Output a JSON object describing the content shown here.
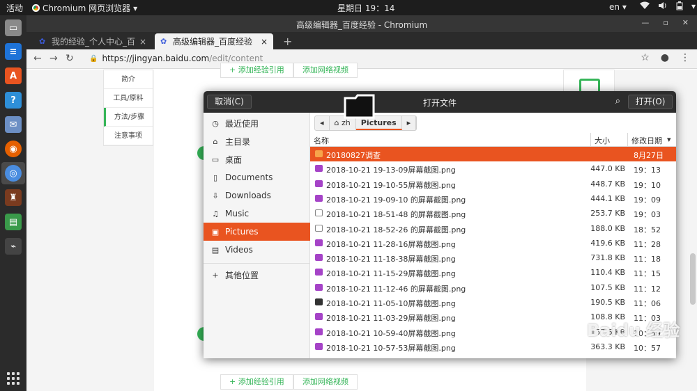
{
  "topbar": {
    "activities": "活动",
    "app_name": "Chromium 网页浏览器",
    "app_caret": "▾",
    "clock": "星期日 19：14",
    "lang": "en",
    "lang_caret": "▾"
  },
  "dock": {
    "icons": [
      "files-icon",
      "writer-icon",
      "software-icon",
      "help-icon",
      "mail-icon",
      "firefox-icon",
      "chromium-icon",
      "wine-icon",
      "system-monitor-icon",
      "scanner-icon"
    ]
  },
  "browser": {
    "window_title": "高级编辑器_百度经验 - Chromium",
    "tabs": [
      {
        "label": "我的经验_个人中心_百度经",
        "close": "×"
      },
      {
        "label": "高级编辑器_百度经验",
        "close": "×"
      }
    ],
    "new_tab": "+",
    "url_host": "https://jingyan.baidu.com",
    "url_path": "/edit/content"
  },
  "page": {
    "steps": [
      "简介",
      "工具/原料",
      "方法/步骤",
      "注意事项"
    ],
    "active_step": "方法/步骤",
    "btn_add_ref": "+ 添加经验引用",
    "btn_add_video": "添加网络视频",
    "top_btn_ref": "+ 添加经验引用",
    "top_btn_video": "添加网络视频"
  },
  "dialog": {
    "title": "打开文件",
    "cancel_label": "取消(C)",
    "open_label": "打开(O)",
    "places": [
      {
        "label": "最近使用",
        "icon": "clock-icon"
      },
      {
        "label": "主目录",
        "icon": "home-icon"
      },
      {
        "label": "桌面",
        "icon": "desktop-icon"
      },
      {
        "label": "Documents",
        "icon": "document-icon"
      },
      {
        "label": "Downloads",
        "icon": "download-icon"
      },
      {
        "label": "Music",
        "icon": "music-icon"
      },
      {
        "label": "Pictures",
        "icon": "pictures-icon"
      },
      {
        "label": "Videos",
        "icon": "video-icon"
      }
    ],
    "other_locations": "其他位置",
    "path_home": "zh",
    "path_current": "Pictures",
    "columns": {
      "name": "名称",
      "size": "大小",
      "modified": "修改日期"
    },
    "files": [
      {
        "name": "20180827调查",
        "size": "",
        "date": "8月27日",
        "kind": "folder"
      },
      {
        "name": "2018-10-21 19-13-09屏幕截图.png",
        "size": "447.0 KB",
        "date": "19：13",
        "kind": "png"
      },
      {
        "name": "2018-10-21 19-10-55屏幕截图.png",
        "size": "448.7 KB",
        "date": "19：10",
        "kind": "png"
      },
      {
        "name": "2018-10-21 19-09-10 的屏幕截图.png",
        "size": "444.1 KB",
        "date": "19：09",
        "kind": "png"
      },
      {
        "name": "2018-10-21 18-51-48 的屏幕截图.png",
        "size": "253.7 KB",
        "date": "19：03",
        "kind": "white"
      },
      {
        "name": "2018-10-21 18-52-26 的屏幕截图.png",
        "size": "188.0 KB",
        "date": "18：52",
        "kind": "white"
      },
      {
        "name": "2018-10-21 11-28-16屏幕截图.png",
        "size": "419.6 KB",
        "date": "11：28",
        "kind": "png"
      },
      {
        "name": "2018-10-21 11-18-38屏幕截图.png",
        "size": "731.8 KB",
        "date": "11：18",
        "kind": "png"
      },
      {
        "name": "2018-10-21 11-15-29屏幕截图.png",
        "size": "110.4 KB",
        "date": "11：15",
        "kind": "png"
      },
      {
        "name": "2018-10-21 11-12-46 的屏幕截图.png",
        "size": "107.5 KB",
        "date": "11：12",
        "kind": "png"
      },
      {
        "name": "2018-10-21 11-05-10屏幕截图.png",
        "size": "190.5 KB",
        "date": "11：06",
        "kind": "dark"
      },
      {
        "name": "2018-10-21 11-03-29屏幕截图.png",
        "size": "108.8 KB",
        "date": "11：03",
        "kind": "png"
      },
      {
        "name": "2018-10-21 10-59-40屏幕截图.png",
        "size": "157.5 KB",
        "date": "10：59",
        "kind": "png"
      },
      {
        "name": "2018-10-21 10-57-53屏幕截图.png",
        "size": "363.3 KB",
        "date": "10：57",
        "kind": "png"
      }
    ]
  },
  "watermark": "Baidu 经验",
  "colors": {
    "accent": "#e95420",
    "green": "#35b558",
    "png_icon": "#a543c7"
  }
}
